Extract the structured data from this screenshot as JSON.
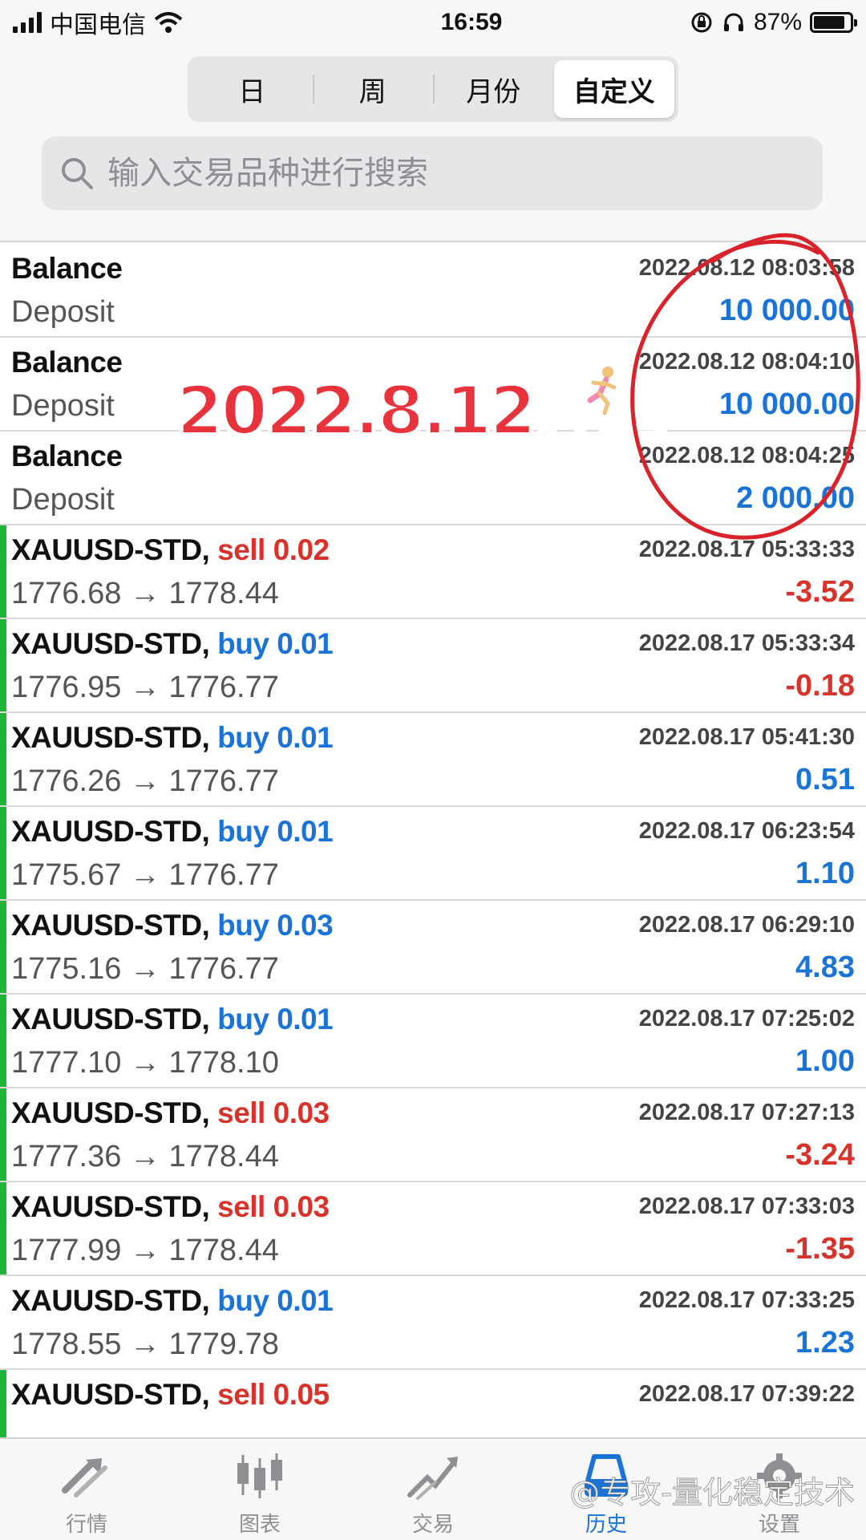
{
  "status_bar": {
    "carrier": "中国电信",
    "time": "16:59",
    "battery": "87%"
  },
  "segments": [
    {
      "label": "日",
      "active": false
    },
    {
      "label": "周",
      "active": false
    },
    {
      "label": "月份",
      "active": false
    },
    {
      "label": "自定义",
      "active": true
    }
  ],
  "search": {
    "placeholder": "输入交易品种进行搜索"
  },
  "balance_rows": [
    {
      "title": "Balance",
      "type": "Deposit",
      "time": "2022.08.12 08:03:58",
      "amount": "10 000.00"
    },
    {
      "title": "Balance",
      "type": "Deposit",
      "time": "2022.08.12 08:04:10",
      "amount": "10 000.00"
    },
    {
      "title": "Balance",
      "type": "Deposit",
      "time": "2022.08.12 08:04:25",
      "amount": "2 000.00"
    }
  ],
  "trades": [
    {
      "symbol": "XAUUSD-STD,",
      "direction": "sell",
      "volume": "0.02",
      "prices": "1776.68 → 1778.44",
      "time": "2022.08.17 05:33:33",
      "profit": "-3.52"
    },
    {
      "symbol": "XAUUSD-STD,",
      "direction": "buy",
      "volume": "0.01",
      "prices": "1776.95 → 1776.77",
      "time": "2022.08.17 05:33:34",
      "profit": "-0.18"
    },
    {
      "symbol": "XAUUSD-STD,",
      "direction": "buy",
      "volume": "0.01",
      "prices": "1776.26 → 1776.77",
      "time": "2022.08.17 05:41:30",
      "profit": "0.51"
    },
    {
      "symbol": "XAUUSD-STD,",
      "direction": "buy",
      "volume": "0.01",
      "prices": "1775.67 → 1776.77",
      "time": "2022.08.17 06:23:54",
      "profit": "1.10"
    },
    {
      "symbol": "XAUUSD-STD,",
      "direction": "buy",
      "volume": "0.03",
      "prices": "1775.16 → 1776.77",
      "time": "2022.08.17 06:29:10",
      "profit": "4.83"
    },
    {
      "symbol": "XAUUSD-STD,",
      "direction": "buy",
      "volume": "0.01",
      "prices": "1777.10 → 1778.10",
      "time": "2022.08.17 07:25:02",
      "profit": "1.00"
    },
    {
      "symbol": "XAUUSD-STD,",
      "direction": "sell",
      "volume": "0.03",
      "prices": "1777.36 → 1778.44",
      "time": "2022.08.17 07:27:13",
      "profit": "-3.24"
    },
    {
      "symbol": "XAUUSD-STD,",
      "direction": "sell",
      "volume": "0.03",
      "prices": "1777.99 → 1778.44",
      "time": "2022.08.17 07:33:03",
      "profit": "-1.35"
    },
    {
      "symbol": "XAUUSD-STD,",
      "direction": "buy",
      "volume": "0.01",
      "prices": "1778.55 → 1779.78",
      "time": "2022.08.17 07:33:25",
      "profit": "1.23"
    },
    {
      "symbol": "XAUUSD-STD,",
      "direction": "sell",
      "volume": "0.05",
      "prices": "",
      "time": "2022.08.17 07:39:22",
      "profit": ""
    }
  ],
  "annotation": {
    "text": "2022.8.12开跑",
    "color": "#e8333d"
  },
  "tabs": [
    {
      "label": "行情",
      "icon": "quotes-arrows-icon",
      "active": false
    },
    {
      "label": "图表",
      "icon": "candlestick-chart-icon",
      "active": false
    },
    {
      "label": "交易",
      "icon": "trade-chart-icon",
      "active": false
    },
    {
      "label": "历史",
      "icon": "history-tray-icon",
      "active": true
    },
    {
      "label": "设置",
      "icon": "gear-icon",
      "active": false
    }
  ],
  "watermark": "@专攻-量化稳定技术",
  "colors": {
    "profit": "#1a73d6",
    "loss": "#d8332b",
    "trade_bar": "#1fb53a",
    "active_tab": "#1a73d6"
  }
}
